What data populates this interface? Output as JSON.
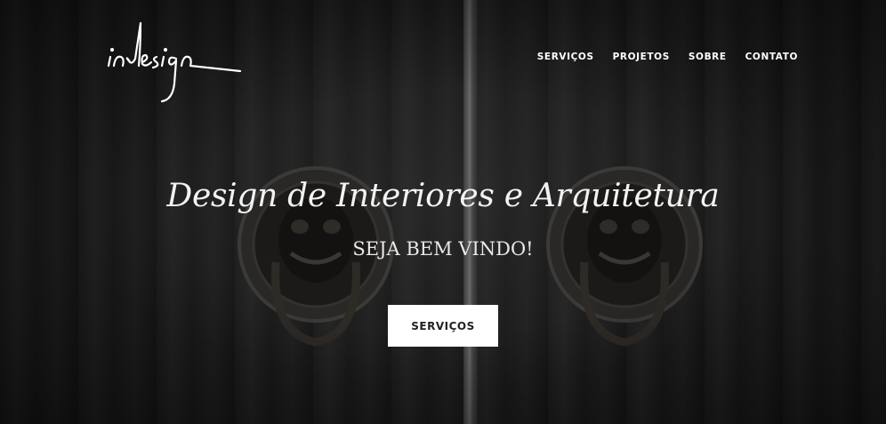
{
  "brand": {
    "logo_text": "indesign"
  },
  "nav": {
    "items": [
      {
        "label": "SERVIÇOS"
      },
      {
        "label": "PROJETOS"
      },
      {
        "label": "SOBRE"
      },
      {
        "label": "CONTATO"
      }
    ]
  },
  "hero": {
    "headline": "Design de Interiores e Arquitetura",
    "subheadline": "SEJA BEM VINDO!",
    "cta_label": "SERVIÇOS"
  },
  "colors": {
    "text": "#ffffff",
    "button_bg": "#ffffff",
    "button_text": "#222222"
  }
}
